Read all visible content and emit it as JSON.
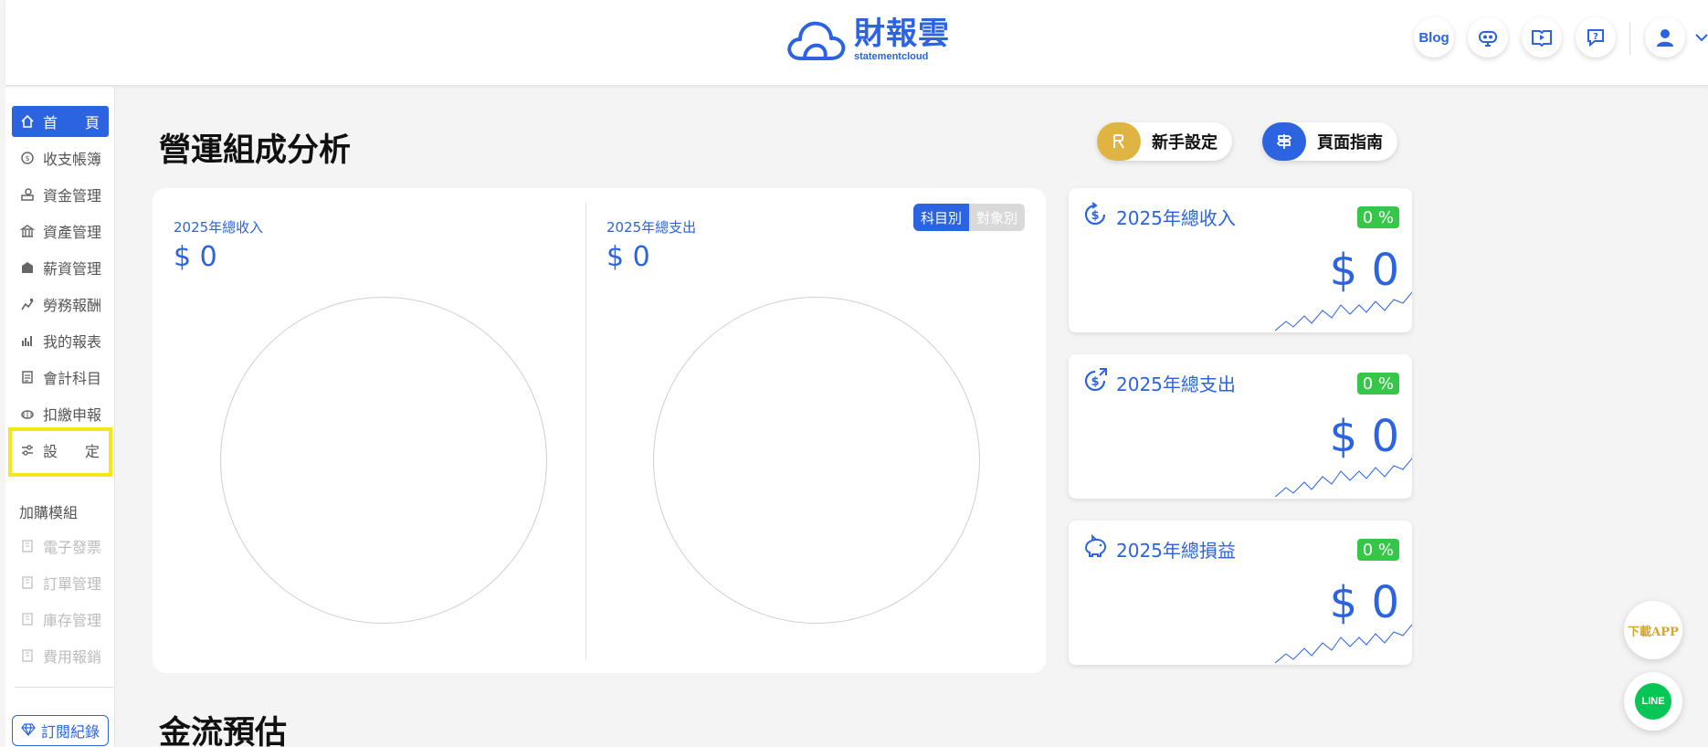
{
  "brand": {
    "name_cn": "財報雲",
    "name_en": "statementcloud"
  },
  "header": {
    "blog_label": "Blog",
    "icons": [
      "robot-icon",
      "video-guide-icon",
      "help-chat-icon"
    ],
    "user_icon": "user-icon"
  },
  "sidebar": {
    "items": [
      {
        "label": "首　　頁",
        "icon": "home-icon"
      },
      {
        "label": "收支帳簿",
        "icon": "coin-cycle-icon"
      },
      {
        "label": "資金管理",
        "icon": "hand-money-icon"
      },
      {
        "label": "資產管理",
        "icon": "building-icon"
      },
      {
        "label": "薪資管理",
        "icon": "payroll-icon"
      },
      {
        "label": "勞務報酬",
        "icon": "labor-icon"
      },
      {
        "label": "我的報表",
        "icon": "bar-chart-icon"
      },
      {
        "label": "會計科目",
        "icon": "ledger-icon"
      },
      {
        "label": "扣繳申報",
        "icon": "coins-icon"
      },
      {
        "label": "設　　定",
        "icon": "settings-sliders-icon"
      }
    ],
    "addon_section": "加購模組",
    "addons": [
      {
        "label": "電子發票"
      },
      {
        "label": "訂單管理"
      },
      {
        "label": "庫存管理"
      },
      {
        "label": "費用報銷"
      }
    ],
    "subscription_label": "訂閱紀錄"
  },
  "main": {
    "title": "營運組成分析",
    "buttons": {
      "setup": "新手設定",
      "guide": "頁面指南"
    },
    "composition": {
      "income_label": "2025年總收入",
      "income_value": "$ 0",
      "expense_label": "2025年總支出",
      "expense_value": "$ 0",
      "toggle": {
        "active": "科目別",
        "inactive": "對象別"
      }
    },
    "cards": [
      {
        "title": "2025年總收入",
        "pct": "0 %",
        "value": "$ 0",
        "icon": "income-dollar-icon"
      },
      {
        "title": "2025年總支出",
        "pct": "0 %",
        "value": "$ 0",
        "icon": "expense-dollar-icon"
      },
      {
        "title": "2025年總損益",
        "pct": "0 %",
        "value": "$ 0",
        "icon": "piggy-bank-icon"
      }
    ],
    "section2_title": "金流預估"
  },
  "floating": {
    "download_app": "下載APP",
    "line": "LINE"
  },
  "colors": {
    "primary": "#2b63e0",
    "green": "#35c64a",
    "setup_gold": "#e0b443",
    "highlight": "#f7e51b"
  }
}
